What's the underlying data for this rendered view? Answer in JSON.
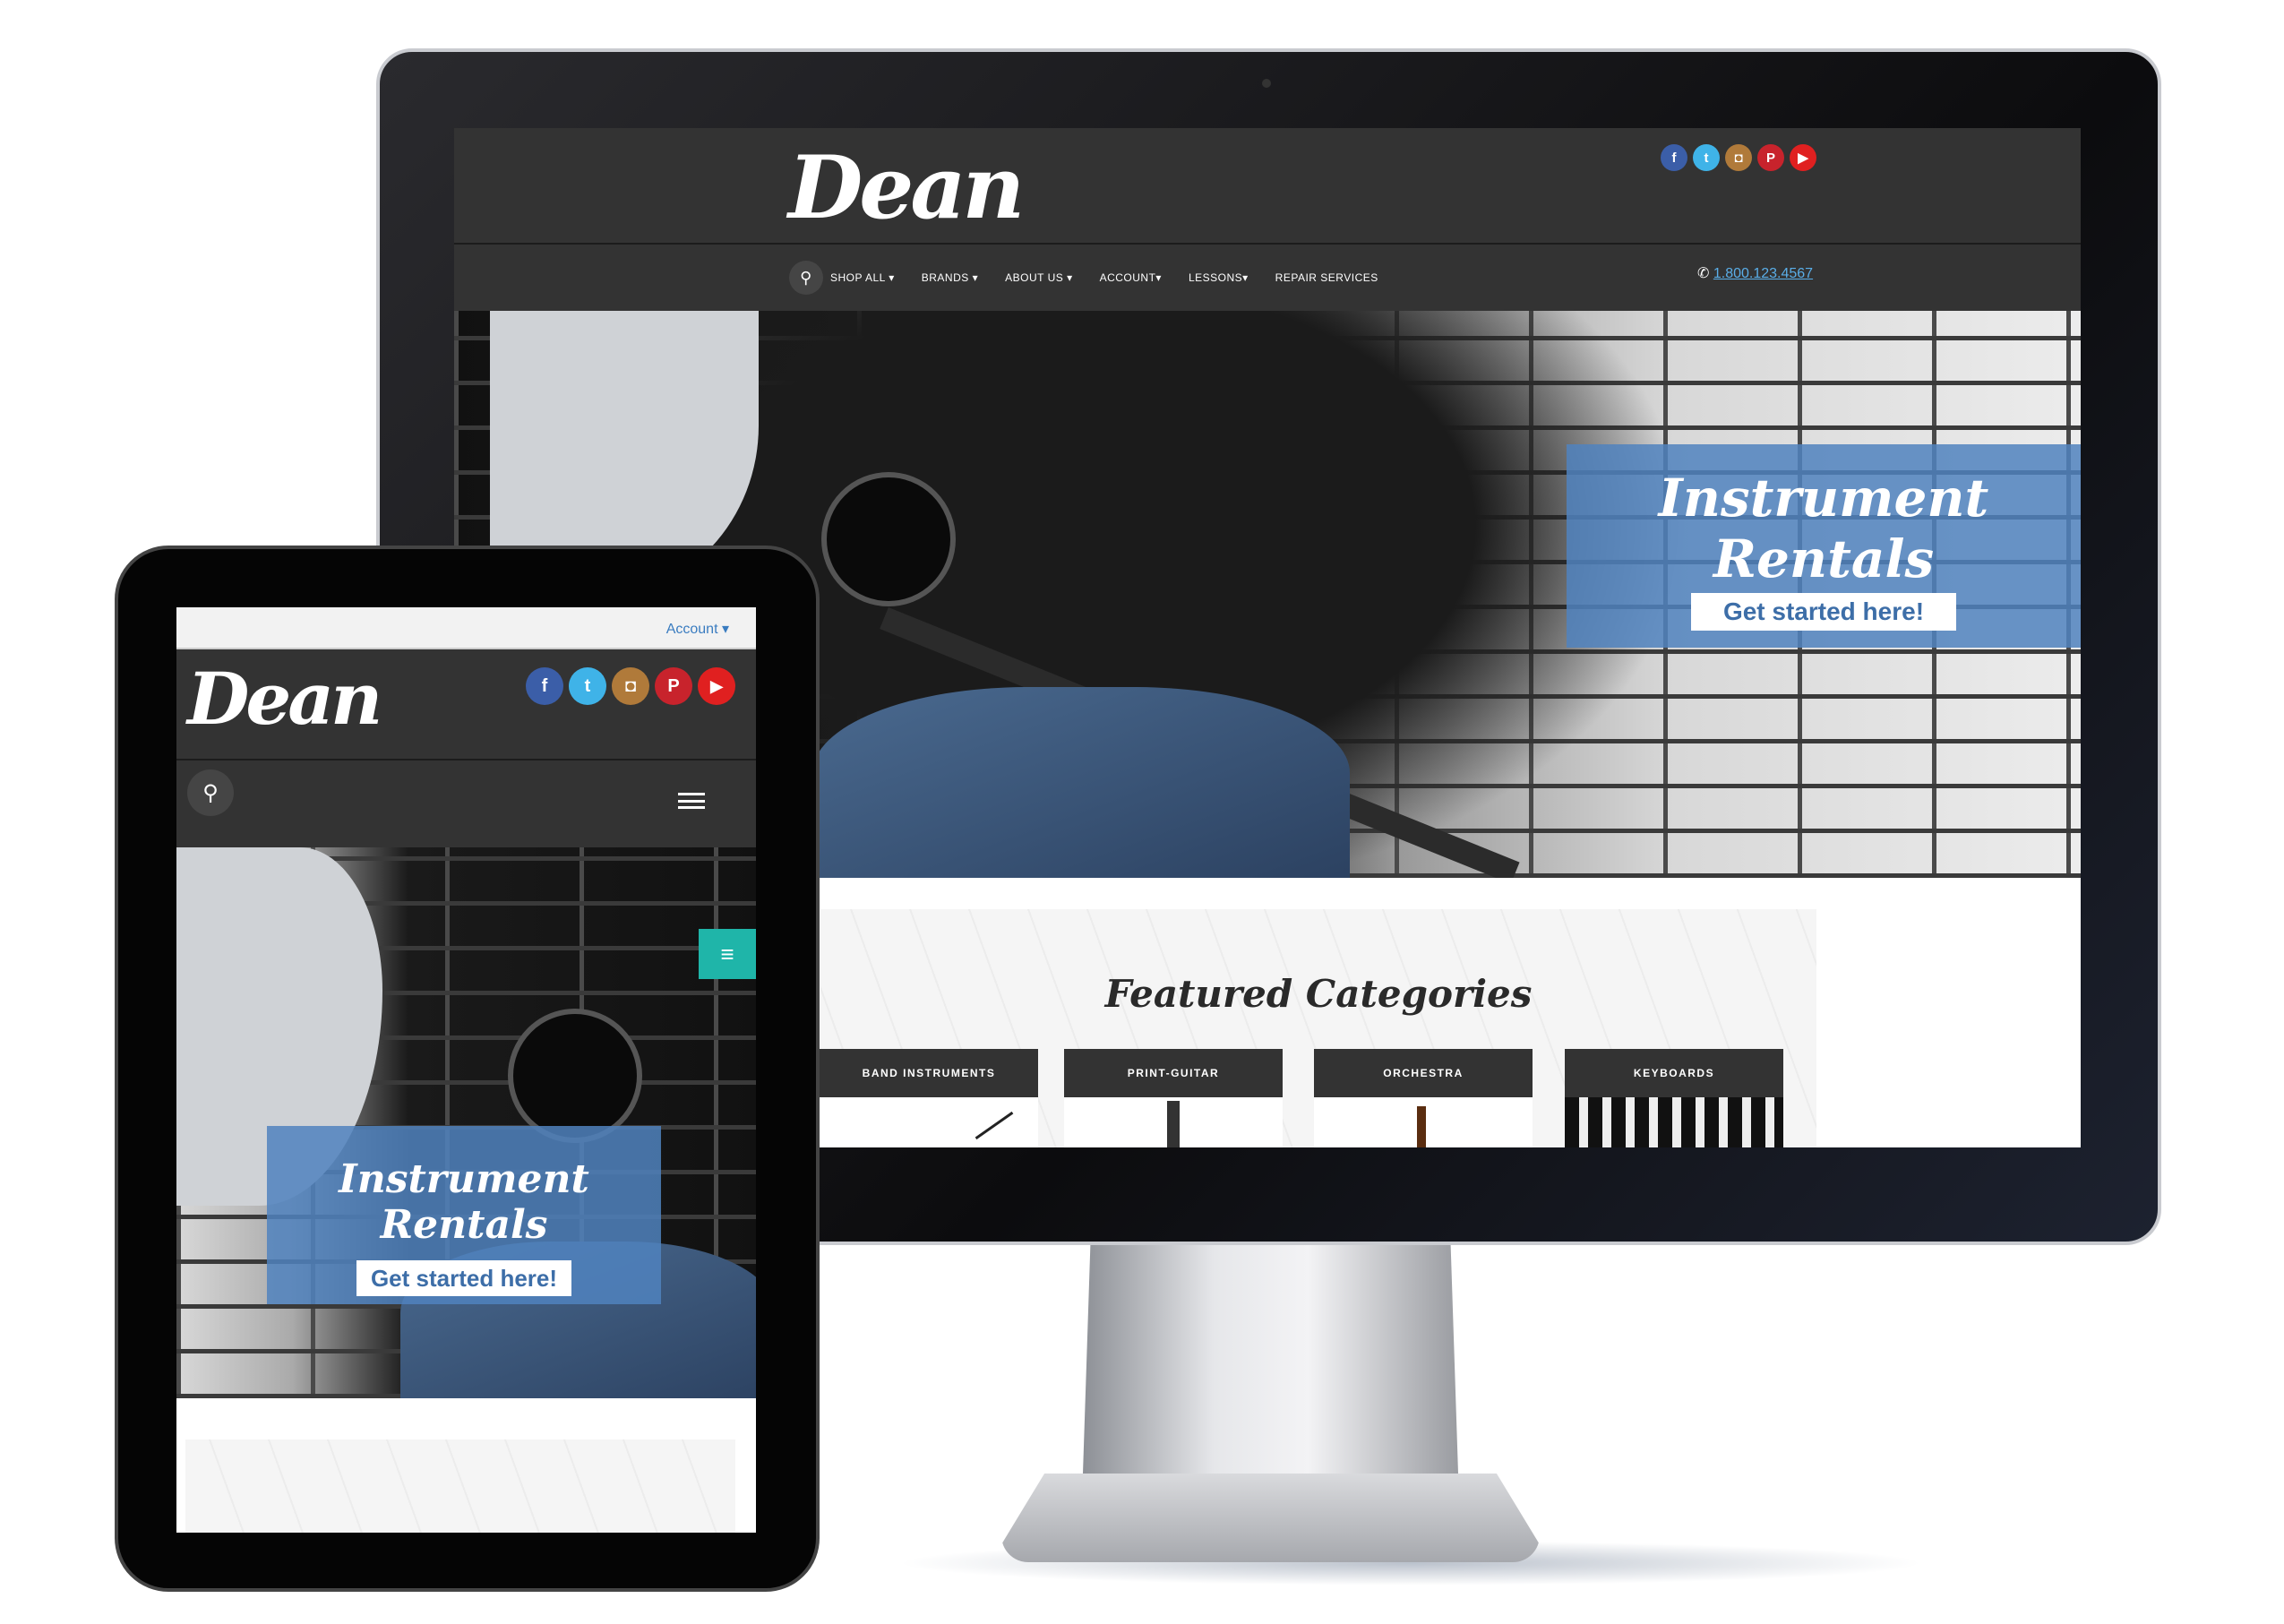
{
  "brand": {
    "logo": "Dean"
  },
  "social": [
    {
      "name": "facebook-icon",
      "glyph": "f",
      "color": "#3b5ea8"
    },
    {
      "name": "twitter-icon",
      "glyph": "t",
      "color": "#3fb3e8"
    },
    {
      "name": "instagram-icon",
      "glyph": "◘",
      "color": "#b07a3a"
    },
    {
      "name": "pinterest-icon",
      "glyph": "P",
      "color": "#c8232c"
    },
    {
      "name": "youtube-icon",
      "glyph": "▶",
      "color": "#e02020"
    }
  ],
  "desktop": {
    "nav": [
      "SHOP ALL ▾",
      "BRANDS ▾",
      "ABOUT US ▾",
      "ACCOUNT▾",
      "LESSONS▾",
      "REPAIR SERVICES"
    ],
    "phone": "1.800.123.4567",
    "hero": {
      "title": "Instrument Rentals",
      "button": "Get started here!"
    },
    "featured": {
      "title": "Featured Categories",
      "cards": [
        "BAND INSTRUMENTS",
        "PRINT-GUITAR",
        "ORCHESTRA",
        "KEYBOARDS"
      ]
    }
  },
  "tablet": {
    "account": "Account ▾",
    "hero": {
      "title": "Instrument Rentals",
      "button": "Get started here!"
    }
  },
  "colors": {
    "header": "#333333",
    "banner": "#5082be",
    "link": "#5aaee8",
    "teal": "#1fb5a9"
  }
}
